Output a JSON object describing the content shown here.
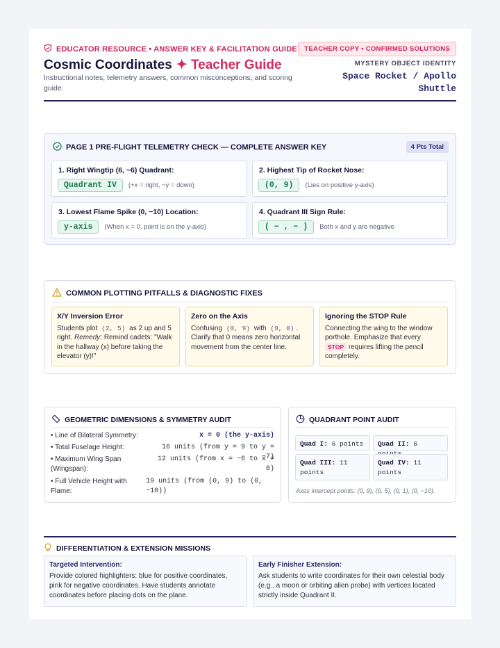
{
  "header": {
    "eyebrow": "EDUCATOR RESOURCE • ANSWER KEY & FACILITATION GUIDE",
    "title_main": "Cosmic Coordinates",
    "title_accent": "✦ Teacher Guide",
    "subtitle": "Instructional notes, telemetry answers, common misconceptions, and scoring guide.",
    "badge": "TEACHER COPY • CONFIRMED SOLUTIONS",
    "identity_label": "MYSTERY OBJECT IDENTITY",
    "identity_value": "Space Rocket / Apollo Shuttle"
  },
  "answer_key": {
    "title": "PAGE 1 PRE-FLIGHT TELEMETRY CHECK — COMPLETE ANSWER KEY",
    "points": "4 Pts Total",
    "items": [
      {
        "label": "1. Right Wingtip (6, −6) Quadrant:",
        "answer": "Quadrant IV",
        "note": "(+x = right, −y = down)"
      },
      {
        "label": "2. Highest Tip of Rocket Nose:",
        "answer": "(0, 9)",
        "note": "(Lies on positive y-axis)"
      },
      {
        "label": "3. Lowest Flame Spike (0, −10) Location:",
        "answer": "y-axis",
        "note": "(When x = 0, point is on the y-axis)"
      },
      {
        "label": "4. Quadrant III Sign Rule:",
        "answer": "( − , − )",
        "note": "Both x and y are negative"
      }
    ]
  },
  "pitfalls": {
    "title": "COMMON PLOTTING PITFALLS & DIAGNOSTIC FIXES",
    "c1": {
      "heading": "X/Y Inversion Error",
      "t1": "Students plot",
      "code": "(2, 5)",
      "t2": "as 2 up and 5 right.",
      "remedy": "Remedy:",
      "t3": "Remind cadets: \"Walk in the hallway (x) before taking the elevator (y)!\""
    },
    "c2": {
      "heading": "Zero on the Axis",
      "t1": "Confusing",
      "code1": "(0, 9)",
      "t2": "with",
      "code2": "(9, 0)",
      "t3": ". Clarify that 0 means zero horizontal movement from the center line."
    },
    "c3": {
      "heading": "Ignoring the STOP Rule",
      "t1": "Connecting the wing to the window porthole. Emphasize that every",
      "stop": "STOP",
      "t2": "requires lifting the pencil completely."
    }
  },
  "geometry": {
    "title": "GEOMETRIC DIMENSIONS & SYMMETRY AUDIT",
    "rows": [
      {
        "k": "• Line of Bilateral Symmetry:",
        "v": "x = 0 (the y-axis)"
      },
      {
        "k": "• Total Fuselage Height:",
        "v": "16 units (from y = 9 to y = −7)"
      },
      {
        "k": "• Maximum Wing Span (Wingspan):",
        "v": "12 units (from x = −6 to x = 6)"
      },
      {
        "k": "• Full Vehicle Height with Flame:",
        "v": "19 units (from (0, 9) to (0, −10))"
      }
    ]
  },
  "quadrants": {
    "title": "QUADRANT POINT AUDIT",
    "cells": [
      {
        "k": "Quad I:",
        "v": "6 points"
      },
      {
        "k": "Quad II:",
        "v": "6 points"
      },
      {
        "k": "Quad III:",
        "v": "11 points"
      },
      {
        "k": "Quad IV:",
        "v": "11 points"
      }
    ],
    "foot": "Axes intercept points: (0, 9), (0, 5), (0, 1), (0, −10)."
  },
  "differentiation": {
    "title": "DIFFERENTIATION & EXTENSION MISSIONS",
    "left": {
      "heading": "Targeted Intervention:",
      "body": "Provide colored highlighters: blue for positive coordinates, pink for negative coordinates. Have students annotate coordinates before placing dots on the plane."
    },
    "right": {
      "heading": "Early Finisher Extension:",
      "body": "Ask students to write coordinates for their own celestial body (e.g., a moon or orbiting alien probe) with vertices located strictly inside Quadrant II."
    }
  }
}
